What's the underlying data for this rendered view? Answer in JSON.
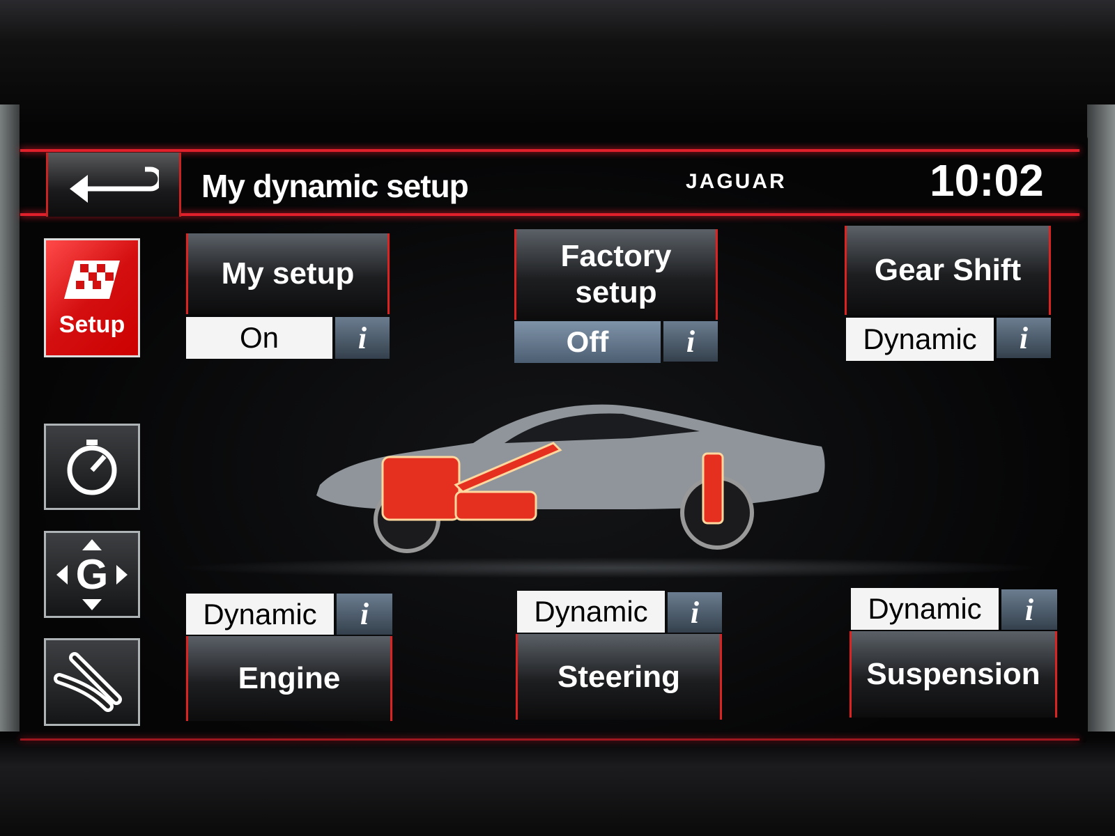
{
  "header": {
    "back_icon": "back-arrow-icon",
    "title": "My dynamic setup",
    "brand": "JAGUAR",
    "time": "10:02"
  },
  "sidebar": {
    "items": [
      {
        "label": "Setup",
        "icon": "checkered-flag-icon",
        "active": true
      },
      {
        "icon": "stopwatch-icon"
      },
      {
        "icon": "g-force-icon",
        "glyph": "G"
      },
      {
        "icon": "track-icon"
      }
    ]
  },
  "top_tiles": [
    {
      "label": "My setup",
      "status": "On",
      "info": "i"
    },
    {
      "label": "Factory setup",
      "status": "Off",
      "info": "i"
    },
    {
      "label": "Gear Shift",
      "status": "Dynamic",
      "info": "i"
    }
  ],
  "bottom_tiles": [
    {
      "label": "Engine",
      "status": "Dynamic",
      "info": "i"
    },
    {
      "label": "Steering",
      "status": "Dynamic",
      "info": "i"
    },
    {
      "label": "Suspension",
      "status": "Dynamic",
      "info": "i"
    }
  ],
  "colors": {
    "accent": "#e0202a",
    "setup_active": "#d40f10",
    "status_blue": "#6a7f95"
  }
}
